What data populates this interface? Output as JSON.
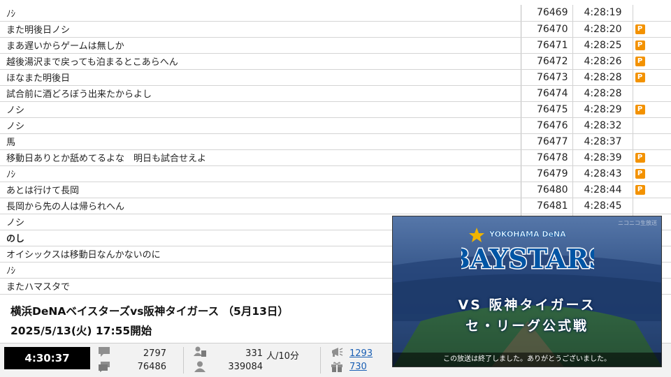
{
  "comments": [
    {
      "text": "ﾉｼ",
      "no": "76469",
      "time": "4:28:19",
      "premium": false
    },
    {
      "text": "また明後日ノシ",
      "no": "76470",
      "time": "4:28:20",
      "premium": true
    },
    {
      "text": "まあ遅いからゲームは無しか",
      "no": "76471",
      "time": "4:28:25",
      "premium": true
    },
    {
      "text": "越後湯沢まで戻っても泊まるとこあらへん",
      "no": "76472",
      "time": "4:28:26",
      "premium": true
    },
    {
      "text": "ほなまた明後日",
      "no": "76473",
      "time": "4:28:28",
      "premium": true
    },
    {
      "text": "試合前に酒どろぼう出来たからよし",
      "no": "76474",
      "time": "4:28:28",
      "premium": false
    },
    {
      "text": "ノシ",
      "no": "76475",
      "time": "4:28:29",
      "premium": true
    },
    {
      "text": "ノシ",
      "no": "76476",
      "time": "4:28:32",
      "premium": false
    },
    {
      "text": "馬",
      "no": "76477",
      "time": "4:28:37",
      "premium": false
    },
    {
      "text": "移動日ありとか舐めてるよな　明日も試合せえよ",
      "no": "76478",
      "time": "4:28:39",
      "premium": true
    },
    {
      "text": "ﾉｼ",
      "no": "76479",
      "time": "4:28:43",
      "premium": true
    },
    {
      "text": "あとは行けて長岡",
      "no": "76480",
      "time": "4:28:44",
      "premium": true
    },
    {
      "text": "長岡から先の人は帰られへん",
      "no": "76481",
      "time": "4:28:45",
      "premium": false
    },
    {
      "text": "ノシ",
      "no": "",
      "time": "",
      "premium": false
    },
    {
      "text": "のし",
      "no": "",
      "time": "",
      "premium": false,
      "bold": true
    },
    {
      "text": "オイシックスは移動日なんかないのに",
      "no": "",
      "time": "",
      "premium": false
    },
    {
      "text": "ﾉｼ",
      "no": "",
      "time": "",
      "premium": false
    },
    {
      "text": "またハマスタで",
      "no": "",
      "time": "",
      "premium": false
    }
  ],
  "premium_badge": "P",
  "program": {
    "title": "横浜DeNAベイスターズvs阪神タイガース （5月13日）",
    "start": "2025/5/13(火) 17:55開始"
  },
  "status": {
    "elapsed": "4:30:37",
    "comment_icon": "comment-icon",
    "comment_speed": "2797",
    "comment_total": "76486",
    "viewer_icon": "viewer-icon",
    "active_viewers": "331",
    "active_unit": "人/10分",
    "total_viewers": "339084",
    "ad_icon": "megaphone-icon",
    "gift_icon": "gift-icon",
    "ad_points": "1293",
    "gift_points": "730"
  },
  "player": {
    "logo_top": "YOKOHAMA DeNA",
    "logo_main": "BAYSTARS",
    "watermark": "ニコニコ生放送",
    "vs_line": "VS 阪神タイガース",
    "league_line": "セ・リーグ公式戦",
    "end_message": "この放送は終了しました。ありがとうございました。",
    "colors": {
      "baystars_blue": "#0055a5",
      "logo_gold": "#f0b400"
    }
  }
}
